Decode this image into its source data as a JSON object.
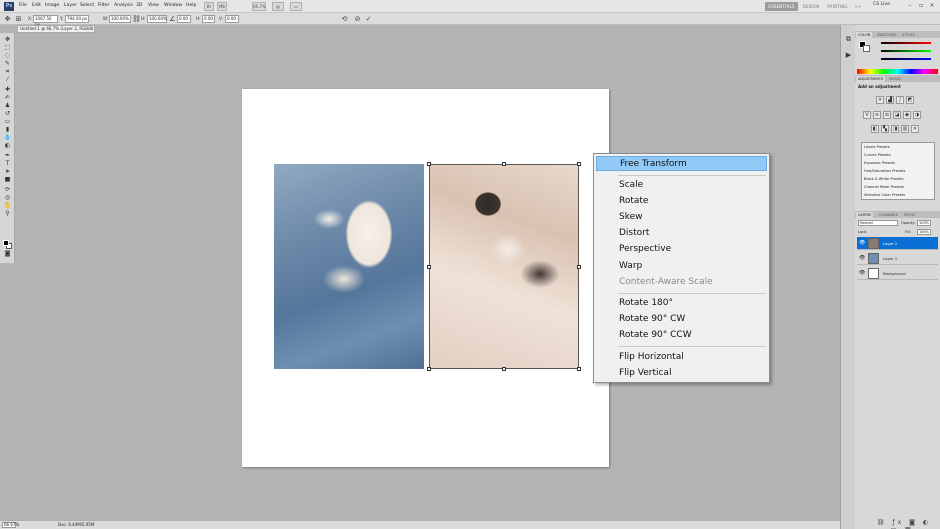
{
  "menubar": {
    "items": [
      "File",
      "Edit",
      "Image",
      "Layer",
      "Select",
      "Filter",
      "Analysis",
      "3D",
      "View",
      "Window",
      "Help"
    ],
    "zoom_value": "66.7%",
    "workspaces": [
      "ESSENTIALS",
      "DESIGN",
      "PAINTING",
      ">>"
    ],
    "active_workspace": "ESSENTIALS",
    "cslive": "CS Live"
  },
  "options": {
    "x_label": "X:",
    "x_value": "1067.50 px",
    "y_label": "Y:",
    "y_value": "794.00 px",
    "w_label": "W:",
    "w_value": "100.00%",
    "h_label": "H:",
    "h_value": "100.00%",
    "angle_value": "0.00",
    "h_skew_label": "H:",
    "h_skew_value": "0.00",
    "v_skew_label": "V:",
    "v_skew_value": "0.00"
  },
  "document": {
    "tab_label": "Untitled-1 @ 66.7% (Layer 2, RGB/8) *"
  },
  "context_menu": {
    "items": [
      "Free Transform",
      "Scale",
      "Rotate",
      "Skew",
      "Distort",
      "Perspective",
      "Warp",
      "Content-Aware Scale",
      "Rotate 180°",
      "Rotate 90° CW",
      "Rotate 90° CCW",
      "Flip Horizontal",
      "Flip Vertical"
    ],
    "highlighted": "Free Transform",
    "disabled": [
      "Content-Aware Scale"
    ]
  },
  "status": {
    "zoom": "66.67%",
    "doc_info": "Doc: 6.44M/5.95M"
  },
  "panels": {
    "color_tabs": [
      "COLOR",
      "SWATCHES",
      "STYLES"
    ],
    "adjust_tabs": [
      "ADJUSTMENTS",
      "MASKS"
    ],
    "adjust_title": "Add an adjustment",
    "presets": [
      "Levels Presets",
      "Curves Presets",
      "Exposure Presets",
      "Hue/Saturation Presets",
      "Black & White Presets",
      "Channel Mixer Presets",
      "Selective Color Presets"
    ],
    "layer_tabs": [
      "LAYERS",
      "CHANNELS",
      "PATHS"
    ],
    "blend_mode": "Normal",
    "opacity_label": "Opacity:",
    "opacity_value": "100%",
    "lock_label": "Lock:",
    "fill_label": "Fill:",
    "fill_value": "100%",
    "layers": [
      "Layer 2",
      "Layer 1",
      "Background"
    ],
    "selected_layer": "Layer 2"
  },
  "colors": {
    "menu_highlight": "#91c9f7",
    "layer_selected": "#0a6fd4"
  }
}
